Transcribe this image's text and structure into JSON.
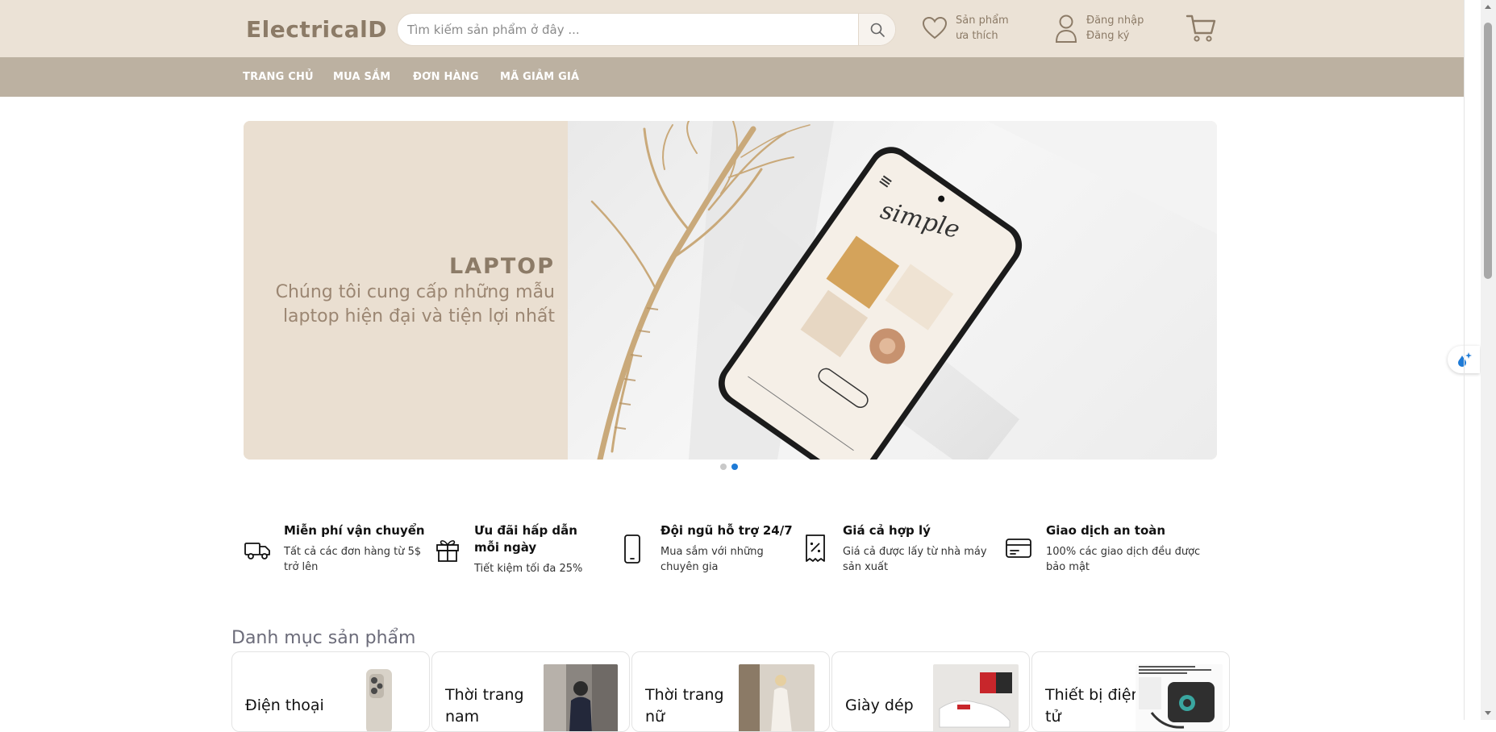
{
  "header": {
    "logo": "ElectricalD",
    "search_placeholder": "Tìm kiếm sản phẩm ở đây ...",
    "wishlist_line1": "Sản phẩm",
    "wishlist_line2": "ưa thích",
    "login_line1": "Đăng nhập",
    "login_line2": "Đăng ký"
  },
  "nav": {
    "items": [
      "TRANG CHỦ",
      "MUA SẮM",
      "ĐƠN HÀNG",
      "MÃ GIẢM GIÁ"
    ]
  },
  "banner": {
    "title": "LAPTOP",
    "subtitle": "Chúng tôi cung cấp những mẫu laptop hiện đại và tiện lợi nhất",
    "phone_script": "simple",
    "slides": 2,
    "active_slide": 2
  },
  "features": [
    {
      "icon": "truck-icon",
      "title": "Miễn phí vận chuyển",
      "desc": "Tất cả các đơn hàng từ 5$ trở lên"
    },
    {
      "icon": "gift-icon",
      "title": "Ưu đãi hấp dẫn mỗi ngày",
      "desc": "Tiết kiệm tối đa 25%"
    },
    {
      "icon": "phone-icon",
      "title": "Đội ngũ hỗ trợ 24/7",
      "desc": "Mua sắm với những chuyên gia"
    },
    {
      "icon": "receipt-percent-icon",
      "title": "Giá cả hợp lý",
      "desc": "Giá cả được lấy từ nhà máy sản xuất"
    },
    {
      "icon": "credit-card-icon",
      "title": "Giao dịch an toàn",
      "desc": "100% các giao dịch đều được bảo mật"
    }
  ],
  "categories": {
    "title": "Danh mục sản phẩm",
    "items": [
      "Điện thoại",
      "Thời trang nam",
      "Thời trang nữ",
      "Giày dép",
      "Thiết bị điện tử"
    ]
  },
  "colors": {
    "header_bg": "#ebe2d6",
    "nav_bg": "#bcb1a1",
    "brand_text": "#8c7b67",
    "slider_active": "#1e7ad6"
  }
}
